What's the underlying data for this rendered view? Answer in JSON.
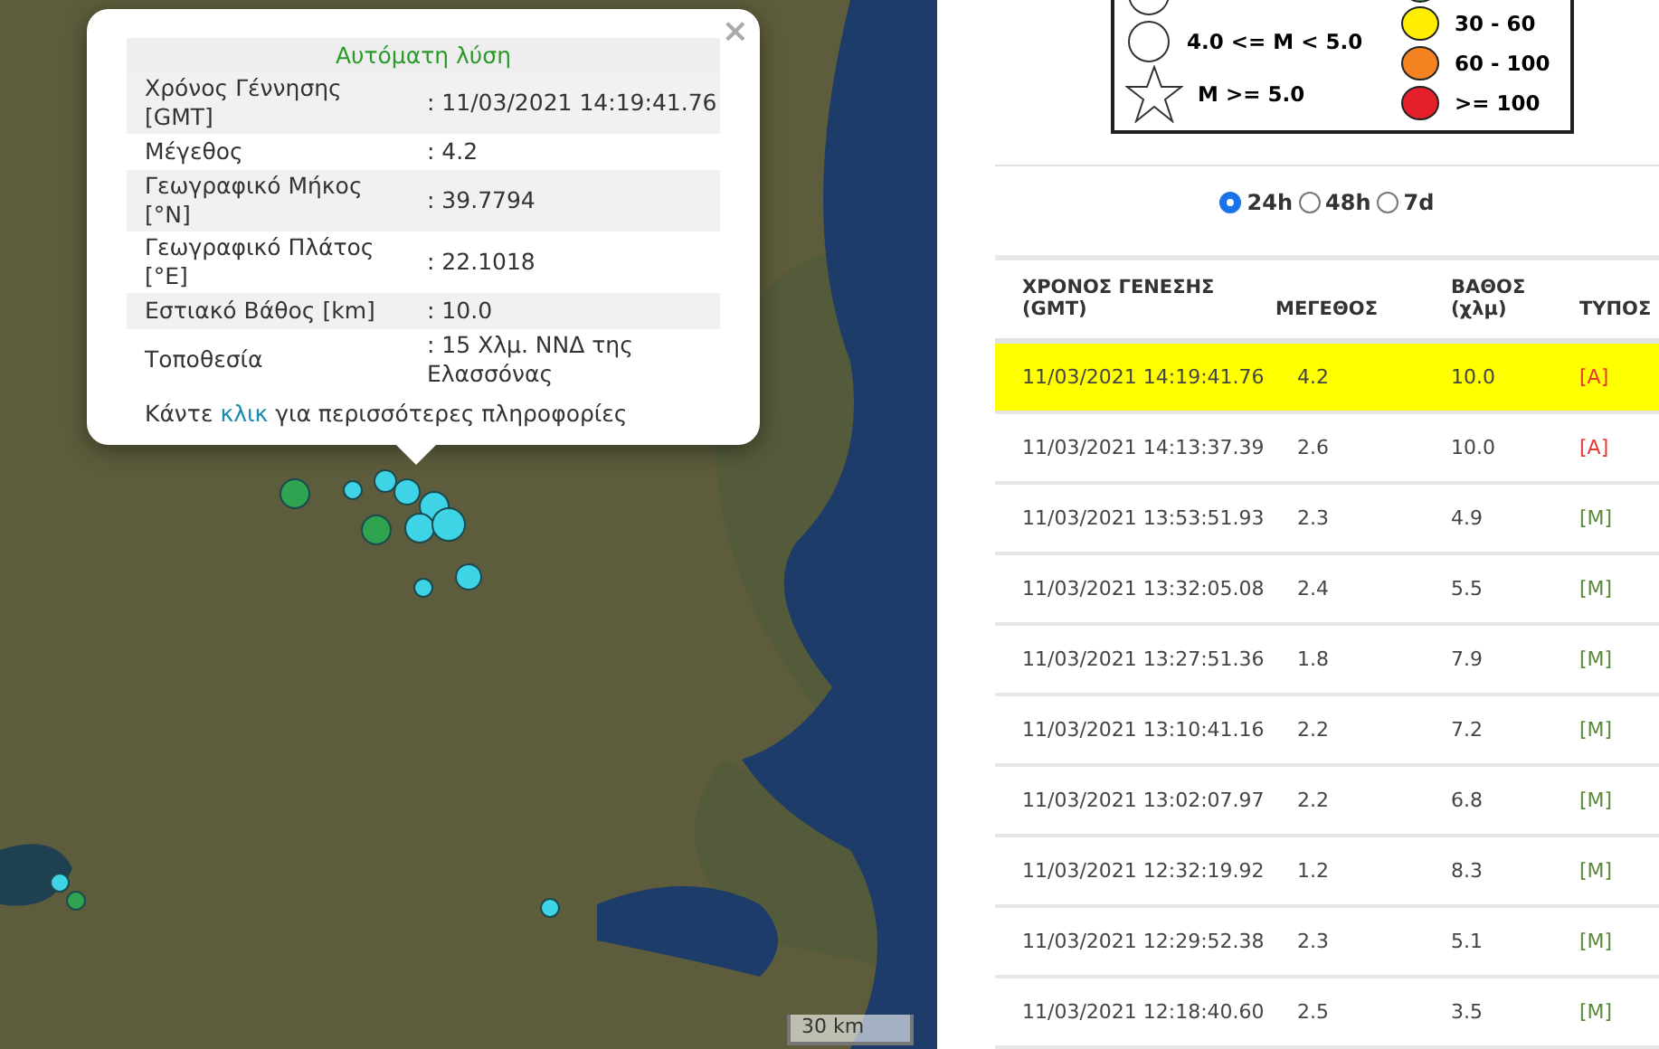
{
  "map": {
    "popup": {
      "title": "Αυτόματη λύση",
      "close": "×",
      "rows": [
        {
          "label": "Χρόνος Γέννησης [GMT]",
          "value": ": 11/03/2021 14:19:41.76"
        },
        {
          "label": "Μέγεθος",
          "value": ": 4.2"
        },
        {
          "label": "Γεωγραφικό Μήκος [°N]",
          "value": ": 39.7794"
        },
        {
          "label": "Γεωγραφικό Πλάτος [°E]",
          "value": ": 22.1018"
        },
        {
          "label": "Εστιακό Βάθος [km]",
          "value": ": 10.0"
        },
        {
          "label": "Τοποθεσία",
          "value": ": 15 Χλμ. ΝΝΔ της Ελασσόνας"
        }
      ],
      "footer_before": "Κάντε",
      "footer_link": "κλικ",
      "footer_after": "για περισσότερες πληροφορίες"
    },
    "scale": "30 km"
  },
  "legend": {
    "magnitudes": [
      {
        "label": "4.0 <= M < 5.0",
        "kind": "circle"
      },
      {
        "label": "M >= 5.0",
        "kind": "star"
      }
    ],
    "depths": [
      {
        "label": "30 - 60",
        "color": "#ffee00"
      },
      {
        "label": "60 - 100",
        "color": "#f58220"
      },
      {
        "label": ">= 100",
        "color": "#e5202a"
      }
    ]
  },
  "periods": [
    {
      "label": "24h",
      "selected": true
    },
    {
      "label": "48h",
      "selected": false
    },
    {
      "label": "7d",
      "selected": false
    }
  ],
  "table": {
    "columns": [
      "ΧΡΟΝΟΣ ΓΕΝΕΣΗΣ (GMT)",
      "ΜΕΓΕΘΟΣ",
      "ΒΑΘΟΣ (χλμ)",
      "ΤΥΠΟΣ"
    ],
    "rows": [
      {
        "time": "11/03/2021 14:19:41.76",
        "magnitude": "4.2",
        "depth": "10.0",
        "type": "[A]",
        "color": "#e53935",
        "selected": true
      },
      {
        "time": "11/03/2021 14:13:37.39",
        "magnitude": "2.6",
        "depth": "10.0",
        "type": "[A]",
        "color": "#e53935",
        "selected": false
      },
      {
        "time": "11/03/2021 13:53:51.93",
        "magnitude": "2.3",
        "depth": "4.9",
        "type": "[M]",
        "color": "#5a8a3a",
        "selected": false
      },
      {
        "time": "11/03/2021 13:32:05.08",
        "magnitude": "2.4",
        "depth": "5.5",
        "type": "[M]",
        "color": "#5a8a3a",
        "selected": false
      },
      {
        "time": "11/03/2021 13:27:51.36",
        "magnitude": "1.8",
        "depth": "7.9",
        "type": "[M]",
        "color": "#5a8a3a",
        "selected": false
      },
      {
        "time": "11/03/2021 13:10:41.16",
        "magnitude": "2.2",
        "depth": "7.2",
        "type": "[M]",
        "color": "#5a8a3a",
        "selected": false
      },
      {
        "time": "11/03/2021 13:02:07.97",
        "magnitude": "2.2",
        "depth": "6.8",
        "type": "[M]",
        "color": "#5a8a3a",
        "selected": false
      },
      {
        "time": "11/03/2021 12:32:19.92",
        "magnitude": "1.2",
        "depth": "8.3",
        "type": "[M]",
        "color": "#5a8a3a",
        "selected": false
      },
      {
        "time": "11/03/2021 12:29:52.38",
        "magnitude": "2.3",
        "depth": "5.1",
        "type": "[M]",
        "color": "#5a8a3a",
        "selected": false
      },
      {
        "time": "11/03/2021 12:18:40.60",
        "magnitude": "2.5",
        "depth": "3.5",
        "type": "[M]",
        "color": "#5a8a3a",
        "selected": false
      }
    ]
  }
}
